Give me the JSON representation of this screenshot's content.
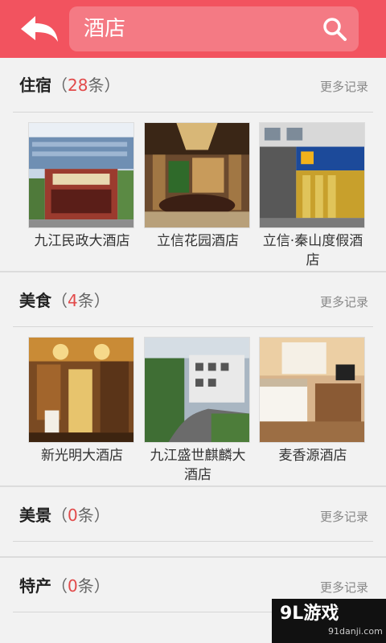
{
  "search": {
    "query": "酒店"
  },
  "sections": [
    {
      "title": "住宿",
      "count_open": "（",
      "count": "28",
      "count_unit": "条",
      "count_close": "）",
      "more": "更多记录",
      "items": [
        {
          "caption": "九江民政大酒店"
        },
        {
          "caption": "立信花园酒店"
        },
        {
          "caption": "立信·秦山度假酒店"
        }
      ]
    },
    {
      "title": "美食",
      "count_open": "（",
      "count": "4",
      "count_unit": "条",
      "count_close": "）",
      "more": "更多记录",
      "items": [
        {
          "caption": "新光明大酒店"
        },
        {
          "caption": "九江盛世麒麟大酒店"
        },
        {
          "caption": "麦香源酒店"
        }
      ]
    },
    {
      "title": "美景",
      "count_open": "（",
      "count": "0",
      "count_unit": "条",
      "count_close": "）",
      "more": "更多记录"
    },
    {
      "title": "特产",
      "count_open": "（",
      "count": "0",
      "count_unit": "条",
      "count_close": "）",
      "more": "更多记录"
    }
  ],
  "watermark": {
    "brand": "9L游戏",
    "domain": "91danji.com"
  },
  "colors": {
    "accent": "#f2535f",
    "count": "#e24a4a"
  }
}
